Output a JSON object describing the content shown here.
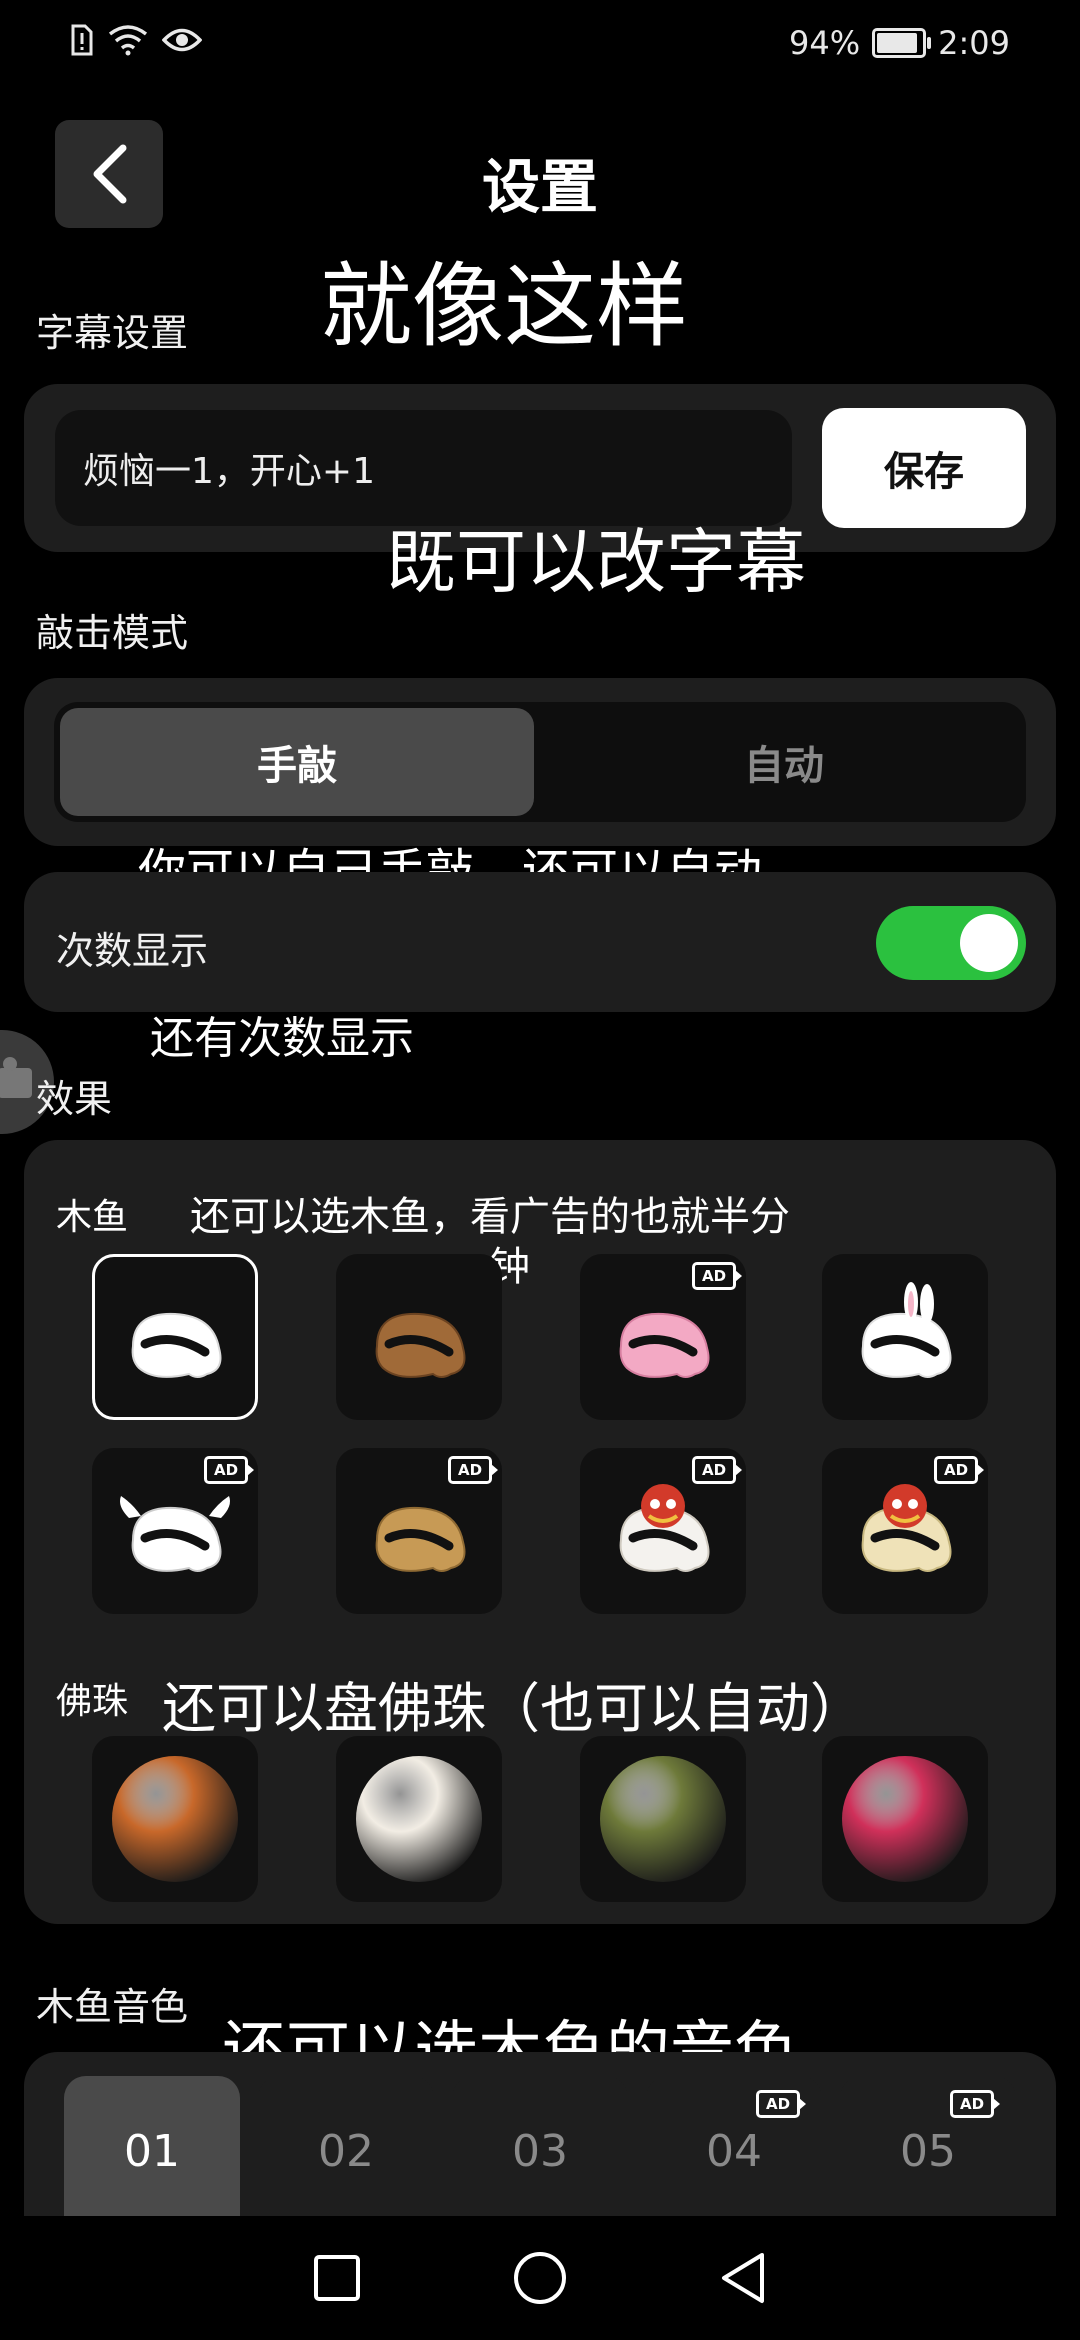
{
  "status_bar": {
    "battery_percent": "94%",
    "battery_level": 0.94,
    "time": "2:09",
    "icons": [
      "alert-sim-icon",
      "wifi-icon",
      "eye-icon",
      "battery-icon"
    ]
  },
  "header": {
    "title": "设置",
    "back_icon": "chevron-left-icon"
  },
  "overlay_captions": {
    "c1": "就像这样",
    "c2": "既可以改字幕",
    "c3": "你可以自己手敲，还可以自动",
    "c4": "还有次数显示",
    "c5": "还可以选木鱼，看广告的也就半分",
    "c5b": "钟",
    "c6": "还可以盘佛珠（也可以自动）",
    "c7": "还可以选木鱼的音色"
  },
  "subtitle_settings": {
    "label": "字幕设置",
    "input_value": "烦恼一1，开心+1",
    "save_label": "保存"
  },
  "tap_mode": {
    "label": "敲击模式",
    "options": [
      "手敲",
      "自动"
    ],
    "selected": "手敲"
  },
  "count_display": {
    "label": "次数显示",
    "enabled": true
  },
  "effects": {
    "label": "效果",
    "muyu_label": "木鱼",
    "beads_label": "佛珠",
    "ad_badge": "AD",
    "muyu_items": [
      {
        "name": "white",
        "ad": false,
        "selected": true
      },
      {
        "name": "wood-brown",
        "ad": false,
        "selected": false
      },
      {
        "name": "pink",
        "ad": true,
        "selected": false
      },
      {
        "name": "bunny",
        "ad": false,
        "selected": false
      },
      {
        "name": "winged",
        "ad": true,
        "selected": false
      },
      {
        "name": "tan-wood",
        "ad": true,
        "selected": false
      },
      {
        "name": "lion-white",
        "ad": true,
        "selected": false
      },
      {
        "name": "lion-cream",
        "ad": true,
        "selected": false
      }
    ],
    "bead_colors": [
      "#c8682a",
      "#f2ede4",
      "#6e7a3a",
      "#d0305a"
    ]
  },
  "sound": {
    "label": "木鱼音色",
    "options": [
      "01",
      "02",
      "03",
      "04",
      "05"
    ],
    "ad_flags": [
      false,
      false,
      false,
      true,
      true
    ],
    "selected": "01"
  },
  "nav": {
    "icons": [
      "recents-square-icon",
      "home-circle-icon",
      "back-triangle-icon"
    ]
  }
}
